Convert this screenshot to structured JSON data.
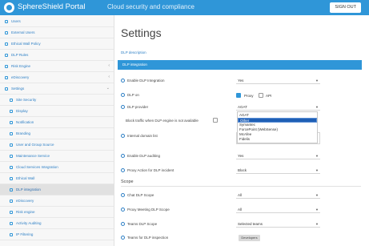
{
  "header": {
    "app_title": "SphereShield Portal",
    "app_subtitle": "Cloud security and compliance",
    "signout_label": "SIGN OUT",
    "brand_color": "#2f96d8"
  },
  "sidebar": {
    "items": [
      {
        "label": "Users",
        "icon": "user-icon",
        "level": 0,
        "chevron": ""
      },
      {
        "label": "External Users",
        "icon": "user-icon",
        "level": 0,
        "chevron": ""
      },
      {
        "label": "Ethical Wall Policy",
        "icon": "wall-icon",
        "level": 0,
        "chevron": ""
      },
      {
        "label": "DLP Rules",
        "icon": "rules-icon",
        "level": 0,
        "chevron": ""
      },
      {
        "label": "Risk Engine",
        "icon": "risk-icon",
        "level": 0,
        "chevron": "‹"
      },
      {
        "label": "eDiscovery",
        "icon": "search-icon",
        "level": 0,
        "chevron": "‹"
      },
      {
        "label": "Settings",
        "icon": "gear-icon",
        "level": 0,
        "chevron": "⌄"
      },
      {
        "label": "Site Security",
        "icon": "shield-icon",
        "level": 1,
        "chevron": ""
      },
      {
        "label": "Display",
        "icon": "display-icon",
        "level": 1,
        "chevron": ""
      },
      {
        "label": "Notification",
        "icon": "bell-icon",
        "level": 1,
        "chevron": ""
      },
      {
        "label": "Branding",
        "icon": "brush-icon",
        "level": 1,
        "chevron": ""
      },
      {
        "label": "User and Group Source",
        "icon": "group-icon",
        "level": 1,
        "chevron": ""
      },
      {
        "label": "Maintenance Service",
        "icon": "wrench-icon",
        "level": 1,
        "chevron": ""
      },
      {
        "label": "Cloud Services Integration",
        "icon": "cloud-icon",
        "level": 1,
        "chevron": ""
      },
      {
        "label": "Ethical Wall",
        "icon": "wall-icon",
        "level": 1,
        "chevron": ""
      },
      {
        "label": "DLP integration",
        "icon": "plug-icon",
        "level": 1,
        "chevron": "",
        "active": true
      },
      {
        "label": "eDiscovery",
        "icon": "search-icon",
        "level": 1,
        "chevron": ""
      },
      {
        "label": "Risk engine",
        "icon": "risk-icon",
        "level": 1,
        "chevron": ""
      },
      {
        "label": "Activity Auditing",
        "icon": "audit-icon",
        "level": 1,
        "chevron": ""
      },
      {
        "label": "IP Filtering",
        "icon": "filter-icon",
        "level": 1,
        "chevron": ""
      }
    ]
  },
  "main": {
    "page_title": "Settings",
    "description_link": "DLP description",
    "section_title": "DLP integration",
    "rows": {
      "enable_integration": {
        "label": "Enable DLP Integration",
        "value": "Yes"
      },
      "dlp_on": {
        "label": "DLP on",
        "proxy_label": "Proxy",
        "proxy_checked": true,
        "api_label": "API",
        "api_checked": false
      },
      "provider": {
        "label": "DLP provider",
        "value": "AGAT"
      },
      "block_traffic": {
        "label": "Block traffic when DLP engine is not available"
      },
      "internal_domain": {
        "label": "Internal domain list"
      },
      "enable_auditing": {
        "label": "Enable DLP auditing",
        "value": "Yes"
      },
      "proxy_action": {
        "label": "Proxy Action for DLP incident",
        "value": "Block"
      }
    },
    "provider_options": [
      "AGAT",
      "Other",
      "Symantec",
      "ForcePoint (WebSense)",
      "McAfee",
      "Fidelis"
    ],
    "provider_selected_index": 1,
    "scope": {
      "title": "Scope",
      "rows": [
        {
          "label": "Chat DLP Scope",
          "value": "All"
        },
        {
          "label": "Proxy Meeting DLP Scope",
          "value": "All"
        },
        {
          "label": "Teams DLP Scope",
          "value": "Selected teams"
        },
        {
          "label": "Teams for DLP inspection",
          "chip": "Developers"
        }
      ]
    }
  }
}
